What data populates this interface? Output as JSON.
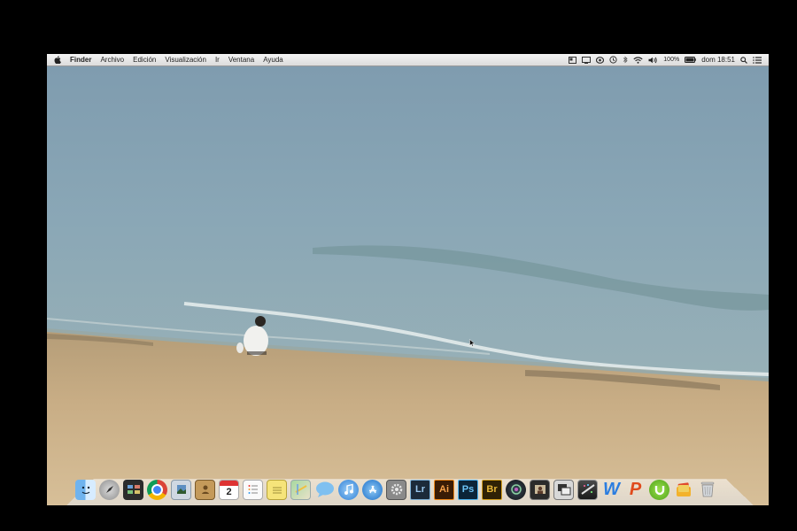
{
  "menubar": {
    "app_name": "Finder",
    "menus": [
      "Archivo",
      "Edición",
      "Visualización",
      "Ir",
      "Ventana",
      "Ayuda"
    ],
    "battery": "100%",
    "clock": "dom 18:51"
  },
  "dock": {
    "adobe": {
      "lightroom": "Lr",
      "illustrator": "Ai",
      "photoshop": "Ps",
      "bridge": "Br"
    },
    "calendar_day": "2",
    "word_letter": "W",
    "powerpoint_letter": "P"
  },
  "colors": {
    "lightroom_bg": "#1c2b3a",
    "illustrator_bg": "#3a1c05",
    "photoshop_bg": "#0c2538",
    "bridge_bg": "#2f2205"
  }
}
